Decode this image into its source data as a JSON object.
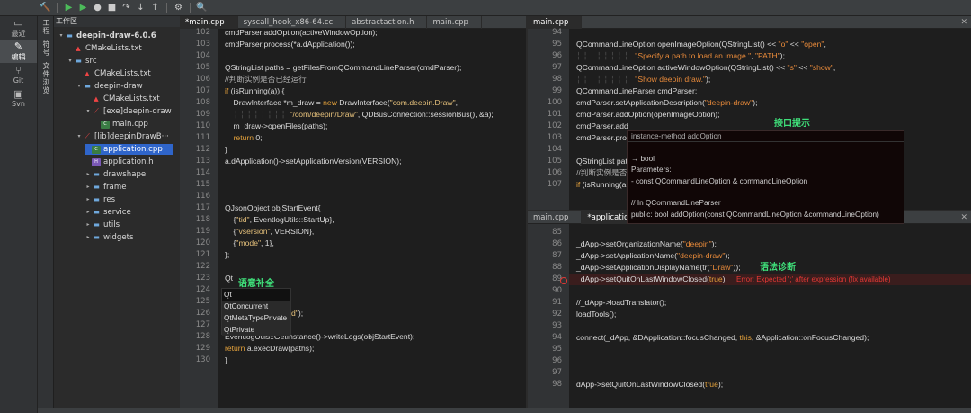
{
  "sidebar": {
    "items": [
      {
        "label": "最近",
        "icon": "clock-icon"
      },
      {
        "label": "编辑",
        "icon": "edit-icon",
        "active": true
      },
      {
        "label": "Git",
        "icon": "git-icon"
      },
      {
        "label": "Svn",
        "icon": "svn-icon"
      }
    ],
    "panel_tabs": [
      "工程",
      "符号",
      "文件浏览"
    ]
  },
  "project": {
    "title": "工作区",
    "nodes": [
      {
        "label": "deepin-draw-6.0.6",
        "type": "root"
      },
      {
        "label": "CMakeLists.txt",
        "type": "cmake"
      },
      {
        "label": "src",
        "type": "folder"
      },
      {
        "label": "CMakeLists.txt",
        "type": "cmake"
      },
      {
        "label": "deepin-draw",
        "type": "folder"
      },
      {
        "label": "CMakeLists.txt",
        "type": "cmake"
      },
      {
        "label": "[exe]deepin-draw",
        "type": "target"
      },
      {
        "label": "main.cpp",
        "type": "cpp"
      },
      {
        "label": "[lib]deepinDrawB···",
        "type": "target"
      },
      {
        "label": "application.cpp",
        "type": "cpp"
      },
      {
        "label": "application.h",
        "type": "h"
      },
      {
        "label": "drawshape",
        "type": "folder"
      },
      {
        "label": "frame",
        "type": "folder"
      },
      {
        "label": "res",
        "type": "folder"
      },
      {
        "label": "service",
        "type": "folder"
      },
      {
        "label": "utils",
        "type": "folder"
      },
      {
        "label": "widgets",
        "type": "folder"
      }
    ]
  },
  "left_editor": {
    "tabs": [
      "*main.cpp",
      "syscall_hook_x86-64.cc",
      "abstractaction.h",
      "main.cpp"
    ],
    "line_numbers": [
      "102",
      "103",
      "104",
      "105",
      "106",
      "107",
      "108",
      "109",
      "110",
      "111",
      "112",
      "113",
      "114",
      "115",
      "116",
      "117",
      "118",
      "119",
      "120",
      "121",
      "122",
      "123",
      "124",
      "125",
      "126",
      "127",
      "128",
      "129",
      "130"
    ],
    "completion": {
      "annotation": "语意补全",
      "typed": "Qt",
      "items": [
        "Qt",
        "QtConcurrent",
        "QtMetaTypePrivate",
        "QtPrivate"
      ]
    }
  },
  "right_top_editor": {
    "tabs": [
      "main.cpp"
    ],
    "line_numbers": [
      "94",
      "95",
      "96",
      "97",
      "98",
      "99",
      "100",
      "101",
      "102",
      "103",
      "104",
      "105",
      "106",
      "107"
    ],
    "tooltip": {
      "annotation": "接口提示",
      "lines": [
        "instance-method addOption",
        "",
        "→ bool",
        "Parameters:",
        "- const QCommandLineOption & commandLineOption",
        "",
        "// In QCommandLineParser",
        "public: bool addOption(const QCommandLineOption &commandLineOption)"
      ]
    }
  },
  "right_bottom_editor": {
    "tabs": [
      "main.cpp",
      "*application.cpp"
    ],
    "line_numbers": [
      "85",
      "86",
      "87",
      "88",
      "89",
      "90",
      "91",
      "92",
      "93",
      "94",
      "95",
      "96",
      "97",
      "98"
    ],
    "diagnostic": {
      "annotation": "语法诊断",
      "message": "Error: Expected ';' after expression (fix available)",
      "error_line": "89"
    }
  },
  "colors": {
    "selection": "#2f65ca",
    "keyword": "#e5a23b",
    "annotation": "#3fe07a",
    "error": "#e53935"
  }
}
